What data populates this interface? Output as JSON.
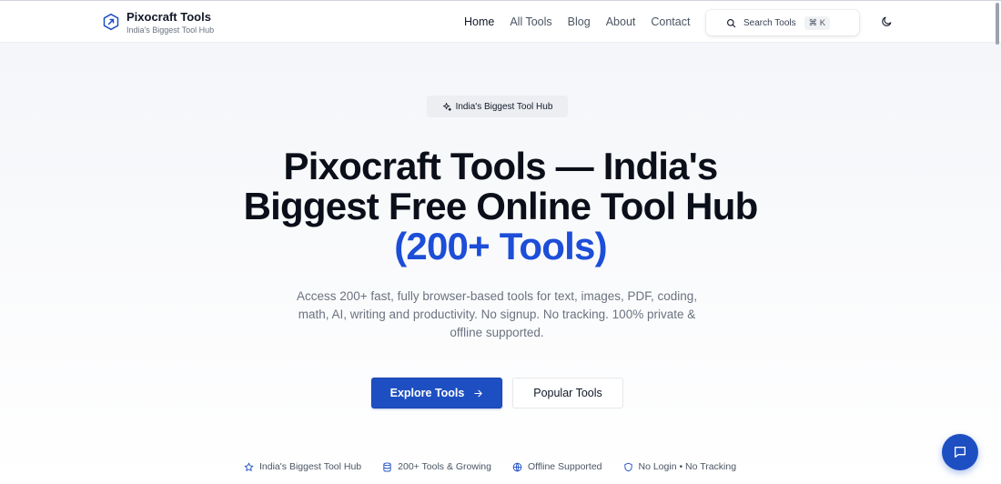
{
  "header": {
    "brand_name": "Pixocraft Tools",
    "brand_tagline": "India's Biggest Tool Hub",
    "nav": [
      {
        "label": "Home",
        "active": true
      },
      {
        "label": "All Tools",
        "active": false
      },
      {
        "label": "Blog",
        "active": false
      },
      {
        "label": "About",
        "active": false
      },
      {
        "label": "Contact",
        "active": false
      }
    ],
    "search_label": "Search Tools",
    "search_shortcut": "⌘ K",
    "theme_icon": "moon-icon"
  },
  "hero": {
    "badge": "India's Biggest Tool Hub",
    "title_line1": "Pixocraft Tools — India's",
    "title_line2": "Biggest Free Online Tool Hub",
    "title_accent": "(200+ Tools)",
    "description": "Access 200+ fast, fully browser-based tools for text, images, PDF, coding, math, AI, writing and productivity. No signup. No tracking. 100% private & offline supported.",
    "primary_button": "Explore Tools",
    "secondary_button": "Popular Tools"
  },
  "features": [
    {
      "icon": "star-icon",
      "label": "India's Biggest Tool Hub"
    },
    {
      "icon": "database-icon",
      "label": "200+ Tools & Growing"
    },
    {
      "icon": "globe-icon",
      "label": "Offline Supported"
    },
    {
      "icon": "shield-icon",
      "label": "No Login • No Tracking"
    }
  ],
  "colors": {
    "accent": "#1d4ed8",
    "primary_button": "#1e4fc2",
    "text": "#111827",
    "muted": "#6b7280"
  },
  "chat_icon": "chat-icon"
}
